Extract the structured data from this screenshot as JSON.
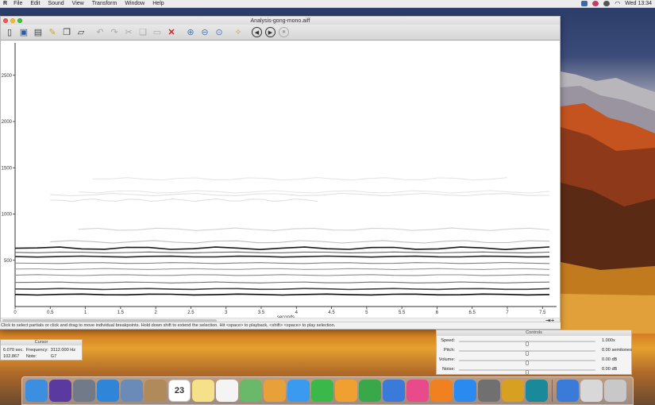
{
  "menubar": {
    "app": "R",
    "items": [
      "File",
      "Edit",
      "Sound",
      "View",
      "Transform",
      "Window",
      "Help"
    ],
    "clock": "Wed 13:34"
  },
  "window": {
    "title": "Analysis-gong-mono.aiff"
  },
  "toolbar": {
    "buttons": [
      {
        "icon": "new-document-icon",
        "enabled": true
      },
      {
        "icon": "save-icon",
        "enabled": true
      },
      {
        "icon": "save-as-icon",
        "enabled": true
      },
      {
        "icon": "edit-icon",
        "enabled": true
      },
      {
        "icon": "copy-icon",
        "enabled": true
      },
      {
        "icon": "document-icon",
        "enabled": true
      },
      {
        "icon": "undo-icon",
        "enabled": false
      },
      {
        "icon": "redo-icon",
        "enabled": false
      },
      {
        "icon": "cut-icon",
        "enabled": false
      },
      {
        "icon": "copy-selection-icon",
        "enabled": false
      },
      {
        "icon": "paste-icon",
        "enabled": false
      },
      {
        "icon": "delete-icon",
        "enabled": true
      },
      {
        "icon": "zoom-in-icon",
        "enabled": true
      },
      {
        "icon": "zoom-out-icon",
        "enabled": true
      },
      {
        "icon": "zoom-fit-icon",
        "enabled": true
      },
      {
        "icon": "wand-icon",
        "enabled": true
      },
      {
        "icon": "rewind-icon",
        "enabled": true
      },
      {
        "icon": "play-icon",
        "enabled": true
      },
      {
        "icon": "stop-icon",
        "enabled": false
      }
    ]
  },
  "chart_data": {
    "type": "line",
    "xlabel": "seconds",
    "ylabel": "",
    "xlim": [
      0,
      7.7
    ],
    "ylim": [
      0,
      2850
    ],
    "xticks": [
      "0",
      "0.5",
      "1",
      "1.5",
      "2",
      "2.5",
      "3",
      "3.5",
      "4",
      "4.5",
      "5",
      "5.5",
      "6",
      "6.5",
      "7",
      "7.5"
    ],
    "yticks": [
      "500",
      "1000",
      "1500",
      "2000",
      "2500"
    ],
    "partials": [
      {
        "start": 0,
        "end": 7.6,
        "freq": 130,
        "darkness": 0.95
      },
      {
        "start": 0,
        "end": 7.6,
        "freq": 190,
        "darkness": 0.75
      },
      {
        "start": 0,
        "end": 7.6,
        "freq": 260,
        "darkness": 0.55
      },
      {
        "start": 0,
        "end": 7.6,
        "freq": 340,
        "darkness": 0.45
      },
      {
        "start": 0,
        "end": 7.6,
        "freq": 405,
        "darkness": 0.4
      },
      {
        "start": 0,
        "end": 7.6,
        "freq": 470,
        "darkness": 0.5
      },
      {
        "start": 0,
        "end": 7.6,
        "freq": 540,
        "darkness": 0.85
      },
      {
        "start": 0,
        "end": 7.6,
        "freq": 585,
        "darkness": 0.6
      },
      {
        "start": 0,
        "end": 7.6,
        "freq": 630,
        "darkness": 0.9
      },
      {
        "start": 0.5,
        "end": 7.6,
        "freq": 700,
        "darkness": 0.25
      },
      {
        "start": 0.9,
        "end": 7.6,
        "freq": 835,
        "darkness": 0.18
      },
      {
        "start": 0.5,
        "end": 4.3,
        "freq": 1150,
        "darkness": 0.12
      },
      {
        "start": 0.5,
        "end": 7.6,
        "freq": 1210,
        "darkness": 0.12
      },
      {
        "start": 0.9,
        "end": 7.6,
        "freq": 1240,
        "darkness": 0.1
      },
      {
        "start": 1.1,
        "end": 7.0,
        "freq": 1380,
        "darkness": 0.1
      }
    ]
  },
  "statusbar": {
    "text": "Click to select partials or click and drag to move individual breakpoints. Hold down shift to extend the selection. Hit <space> to playback, <shift> <space> to play selection."
  },
  "cursor_panel": {
    "title": "Cursor",
    "time": "6.070 sec.",
    "value": "102.867",
    "freq_label": "Frequency:",
    "freq": "3112.000 Hz",
    "note_label": "Note:",
    "note": "G7"
  },
  "controls_panel": {
    "title": "Controls",
    "rows": [
      {
        "label": "Speed:",
        "value": "1.000x",
        "level": 0.5
      },
      {
        "label": "Pitch:",
        "value": "0.00 semitones",
        "level": 0.5
      },
      {
        "label": "Volume:",
        "value": "0.00 dB",
        "level": 0.5
      },
      {
        "label": "Noise:",
        "value": "0.00 dB",
        "level": 0.5
      }
    ]
  },
  "dock": {
    "calendar_day": "23",
    "apps": [
      {
        "icon": "finder-icon",
        "color": "#3b8ee0"
      },
      {
        "icon": "siri-icon",
        "color": "#5a3aa0"
      },
      {
        "icon": "launchpad-icon",
        "color": "#707a88"
      },
      {
        "icon": "safari-icon",
        "color": "#2f86d8"
      },
      {
        "icon": "mail-icon",
        "color": "#6a8ab8"
      },
      {
        "icon": "contacts-icon",
        "color": "#b08a5a"
      },
      {
        "icon": "calendar-icon",
        "color": "#ffffff"
      },
      {
        "icon": "notes-icon",
        "color": "#f6e08a"
      },
      {
        "icon": "reminders-icon",
        "color": "#f4f4f4"
      },
      {
        "icon": "maps-icon",
        "color": "#6ab86a"
      },
      {
        "icon": "photos-icon",
        "color": "#e8a03a"
      },
      {
        "icon": "messages-icon",
        "color": "#3a9af0"
      },
      {
        "icon": "facetime-icon",
        "color": "#3ab84a"
      },
      {
        "icon": "pages-icon",
        "color": "#f0a030"
      },
      {
        "icon": "numbers-icon",
        "color": "#3aa84a"
      },
      {
        "icon": "keynote-icon",
        "color": "#3a7ad8"
      },
      {
        "icon": "itunes-icon",
        "color": "#e84a8a"
      },
      {
        "icon": "ibooks-icon",
        "color": "#f08020"
      },
      {
        "icon": "app-store-icon",
        "color": "#2a8af0"
      },
      {
        "icon": "system-preferences-icon",
        "color": "#707070"
      },
      {
        "icon": "spear-app-icon",
        "color": "#d8a020"
      },
      {
        "icon": "edge-app-icon",
        "color": "#1a8a9a"
      },
      {
        "icon": "network-icon",
        "color": "#3a7ad8"
      },
      {
        "icon": "music-folder-icon",
        "color": "#d8d8d8"
      },
      {
        "icon": "trash-icon",
        "color": "#c8c8c8"
      }
    ]
  }
}
